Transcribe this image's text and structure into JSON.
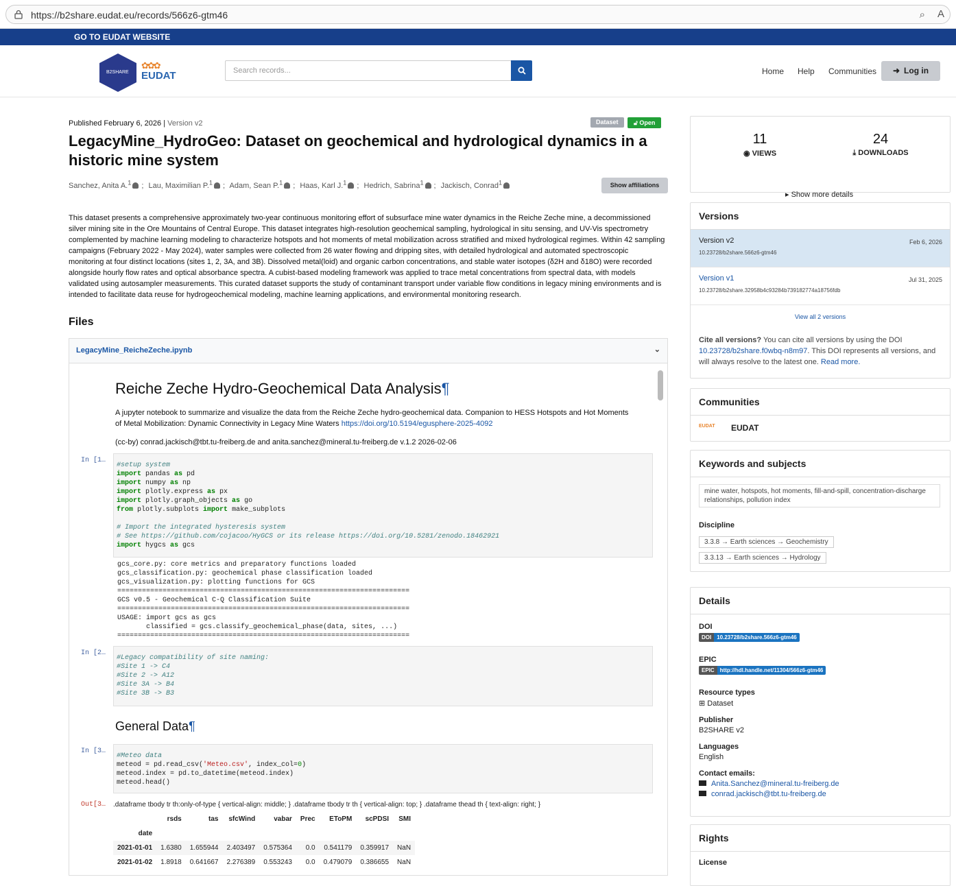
{
  "browser": {
    "url": "https://b2share.eudat.eu/records/566z6-gtm46"
  },
  "topbar": {
    "label": "GO TO EUDAT WEBSITE"
  },
  "header": {
    "logo_hex_text": "B2SHARE",
    "logo_text": "EUDAT",
    "search_placeholder": "Search records...",
    "nav": [
      "Home",
      "Help",
      "Communities"
    ],
    "login_label": "Log in"
  },
  "record": {
    "published": "Published February 6, 2026",
    "version": "Version v2",
    "badge_dataset": "Dataset",
    "badge_open": "Open",
    "title": "LegacyMine_HydroGeo: Dataset on geochemical and hydrological dynamics in a historic mine system",
    "authors": [
      "Sanchez, Anita A.",
      "Lau, Maximilian P.",
      "Adam, Sean P.",
      "Haas, Karl J.",
      "Hedrich, Sabrina",
      "Jackisch, Conrad"
    ],
    "author_sup": "1",
    "show_affiliations": "Show affiliations",
    "description": "This dataset presents a comprehensive approximately two-year continuous monitoring effort of subsurface mine water dynamics in the Reiche Zeche mine, a decommissioned silver mining site in the Ore Mountains of Central Europe. This dataset integrates high-resolution geochemical sampling, hydrological in situ sensing, and UV-Vis spectrometry complemented by machine learning modeling to characterize hotspots and hot moments of metal mobilization across stratified and mixed hydrological regimes. Within 42 sampling campaigns (February 2022 - May 2024), water samples were collected from 26 water flowing and dripping sites, with detailed hydrological and automated spectroscopic monitoring at four distinct locations (sites 1, 2, 3A, and 3B). Dissolved metal(loid) and organic carbon concentrations, and stable water isotopes (δ2H and δ18O) were recorded alongside hourly flow rates and optical absorbance spectra. A cubist-based modeling framework was applied to trace metal concentrations from spectral data, with models validated using autosampler measurements. This curated dataset supports the study of contaminant transport under variable flow conditions in legacy mining environments and is intended to facilitate data reuse for hydrogeochemical modeling, machine learning applications, and environmental monitoring research."
  },
  "files": {
    "heading": "Files",
    "filename": "LegacyMine_ReicheZeche.ipynb"
  },
  "notebook": {
    "h1": "Reiche Zeche Hydro-Geochemical Data Analysis",
    "pilcrow": "¶",
    "intro": "A jupyter notebook to summarize and visualize the data from the Reiche Zeche hydro-geochemical data. Companion to HESS Hotspots and Hot Moments of Metal Mobilization: Dynamic Connectivity in Legacy Mine Waters ",
    "intro_link": "https://doi.org/10.5194/egusphere-2025-4092",
    "credits": "(cc-by) conrad.jackisch@tbt.tu-freiberg.de and anita.sanchez@mineral.tu-freiberg.de v.1.2 2026-02-06",
    "prompt1": "In [1…",
    "prompt2": "In [2…",
    "prompt3": "In [3…",
    "out3": "Out[3…",
    "output1": "gcs_core.py: core metrics and preparatory functions loaded\ngcs_classification.py: geochemical phase classification loaded\ngcs_visualization.py: plotting functions for GCS\n=======================================================================\nGCS v0.5 - Geochemical C-Q Classification Suite\n=======================================================================\nUSAGE: import gcs as gcs\n       classified = gcs.classify_geochemical_phase(data, sites, ...)\n=======================================================================",
    "h2": "General Data",
    "css_text": ".dataframe tbody tr th:only-of-type { vertical-align: middle; } .dataframe tbody tr th { vertical-align: top; } .dataframe thead th { text-align: right; }",
    "table": {
      "columns": [
        "rsds",
        "tas",
        "sfcWind",
        "vabar",
        "Prec",
        "EToPM",
        "scPDSI",
        "SMI"
      ],
      "index_name": "date",
      "rows": [
        {
          "date": "2021-01-01",
          "values": [
            "1.6380",
            "1.655944",
            "2.403497",
            "0.575364",
            "0.0",
            "0.541179",
            "0.359917",
            "NaN"
          ]
        },
        {
          "date": "2021-01-02",
          "values": [
            "1.8918",
            "0.641667",
            "2.276389",
            "0.553243",
            "0.0",
            "0.479079",
            "0.386655",
            "NaN"
          ]
        }
      ]
    }
  },
  "stats": {
    "views": "11",
    "views_label": "VIEWS",
    "downloads": "24",
    "downloads_label": "DOWNLOADS",
    "more": "Show more details"
  },
  "versions": {
    "heading": "Versions",
    "items": [
      {
        "name": "Version v2",
        "date": "Feb 6, 2026",
        "doi": "10.23728/b2share.566z6-gtm46"
      },
      {
        "name": "Version v1",
        "date": "Jul 31, 2025",
        "doi": "10.23728/b2share.32958b4c93284b739182774a18756fdb"
      }
    ],
    "view_all": "View all 2 versions",
    "cite_bold": "Cite all versions?",
    "cite_text1": " You can cite all versions by using the DOI ",
    "cite_doi": "10.23728/b2share.f0wbq-n8m97",
    "cite_text2": ". This DOI represents all versions, and will always resolve to the latest one. ",
    "read_more": "Read more."
  },
  "communities": {
    "heading": "Communities",
    "name": "EUDAT",
    "logo_text": "EUDAT"
  },
  "keywords": {
    "heading": "Keywords and subjects",
    "keywords": "mine water, hotspots, hot moments, fill-and-spill, concentration-discharge relationships, pollution index",
    "discipline_label": "Discipline",
    "disciplines": [
      "3.3.8 → Earth sciences → Geochemistry",
      "3.3.13 → Earth sciences → Hydrology"
    ]
  },
  "details": {
    "heading": "Details",
    "doi_label": "DOI",
    "doi_key": "DOI",
    "doi_value": "10.23728/b2share.566z6-gtm46",
    "epic_label": "EPIC",
    "epic_key": "EPIC",
    "epic_value": "http://hdl.handle.net/11304/566z6-gtm46",
    "resource_label": "Resource types",
    "resource_value": "Dataset",
    "publisher_label": "Publisher",
    "publisher_value": "B2SHARE v2",
    "languages_label": "Languages",
    "languages_value": "English",
    "contact_label": "Contact emails:",
    "emails": [
      "Anita.Sanchez@mineral.tu-freiberg.de",
      "conrad.jackisch@tbt.tu-freiberg.de"
    ]
  },
  "rights": {
    "heading": "Rights",
    "license_label": "License"
  }
}
